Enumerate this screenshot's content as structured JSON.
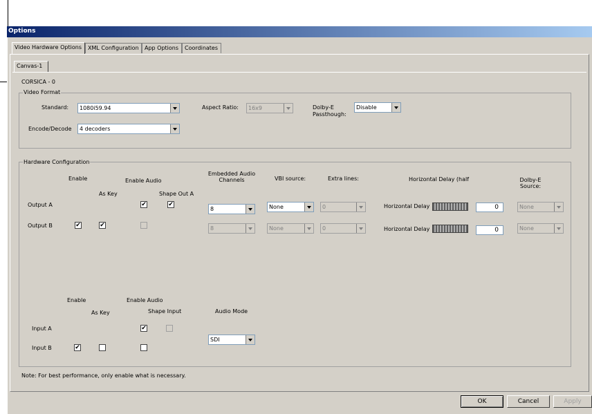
{
  "window": {
    "title": "Options"
  },
  "tabs": [
    "Video Hardware Options",
    "XML Configuration",
    "App Options",
    "Coordinates"
  ],
  "subtab": "Canvas-1",
  "device": "CORSICA - 0",
  "video_format": {
    "group": "Video Format",
    "standard_label": "Standard:",
    "standard_value": "1080i59.94",
    "aspect_label": "Aspect Ratio:",
    "aspect_value": "16x9",
    "dolby_label_1": "Dolby-E",
    "dolby_label_2": "Passthough:",
    "dolby_value": "Disable",
    "encode_label": "Encode/Decode",
    "encode_value": "4 decoders"
  },
  "hardware": {
    "group": "Hardware Configuration",
    "h_enable": "Enable",
    "h_enable_audio": "Enable Audio",
    "h_as_key": "As Key",
    "h_shape_out": "Shape Out A",
    "h_embedded": "Embedded Audio Channels",
    "h_vbi": "VBI source:",
    "h_extra": "Extra lines:",
    "h_hdelay": "Horizontal Delay (half",
    "h_dolby": "Dolby-E Source:",
    "output_a": {
      "label": "Output A",
      "channels": "8",
      "vbi": "None",
      "extra": "0",
      "hd_label": "Horizontal Delay",
      "hd_value": "0",
      "dolby": "None"
    },
    "output_b": {
      "label": "Output B",
      "channels": "8",
      "vbi": "None",
      "extra": "0",
      "hd_label": "Horizontal Delay",
      "hd_value": "0",
      "dolby": "None"
    },
    "in_enable": "Enable",
    "in_enable_audio": "Enable Audio",
    "in_as_key": "As Key",
    "in_shape": "Shape Input",
    "in_audio_mode": "Audio Mode",
    "input_a": {
      "label": "Input A"
    },
    "input_b": {
      "label": "Input B"
    },
    "audio_mode_value": "SDI"
  },
  "note": "Note: For best performance, only enable what is necessary.",
  "buttons": {
    "ok": "OK",
    "cancel": "Cancel",
    "apply": "Apply"
  }
}
